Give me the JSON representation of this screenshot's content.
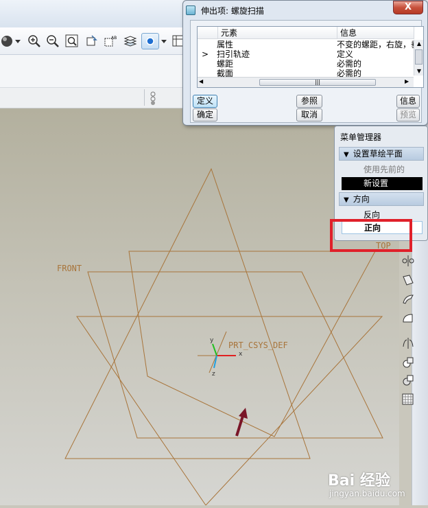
{
  "dialog": {
    "title": "伸出项: 螺旋扫描",
    "close_glyph": "X",
    "columns": [
      "元素",
      "信息"
    ],
    "rows": [
      {
        "marker": "",
        "element": "属性",
        "info": "不变的螺距，右旋，垂"
      },
      {
        "marker": ">",
        "element": "扫引轨迹",
        "info": "定义"
      },
      {
        "marker": "",
        "element": "螺距",
        "info": "必需的"
      },
      {
        "marker": "",
        "element": "截面",
        "info": "必需的"
      }
    ],
    "buttons": {
      "define": "定义",
      "reference": "参照",
      "info": "信息",
      "ok": "确定",
      "cancel": "取消",
      "preview": "预览"
    }
  },
  "menu_manager": {
    "title": "菜单管理器",
    "section1": {
      "title": "设置草绘平面",
      "items": [
        "使用先前的",
        "新设置"
      ]
    },
    "section2": {
      "title": "方向",
      "items": [
        "反向",
        "正向"
      ]
    }
  },
  "viewport": {
    "labels": {
      "front": "FRONT",
      "top": "TOP",
      "csys": "PRT_CSYS_DEF"
    },
    "axes": {
      "x": "x",
      "y": "y",
      "z": "z"
    }
  },
  "watermark": {
    "logo": "Bai 经验",
    "url": "jingyan.baidu.com"
  },
  "colors": {
    "datum": "#a8743a",
    "arrow": "#7a1628",
    "highlight": "#e0202a",
    "axis_x": "#e02020",
    "axis_y": "#20c020",
    "axis_z": "#20a0e0"
  }
}
